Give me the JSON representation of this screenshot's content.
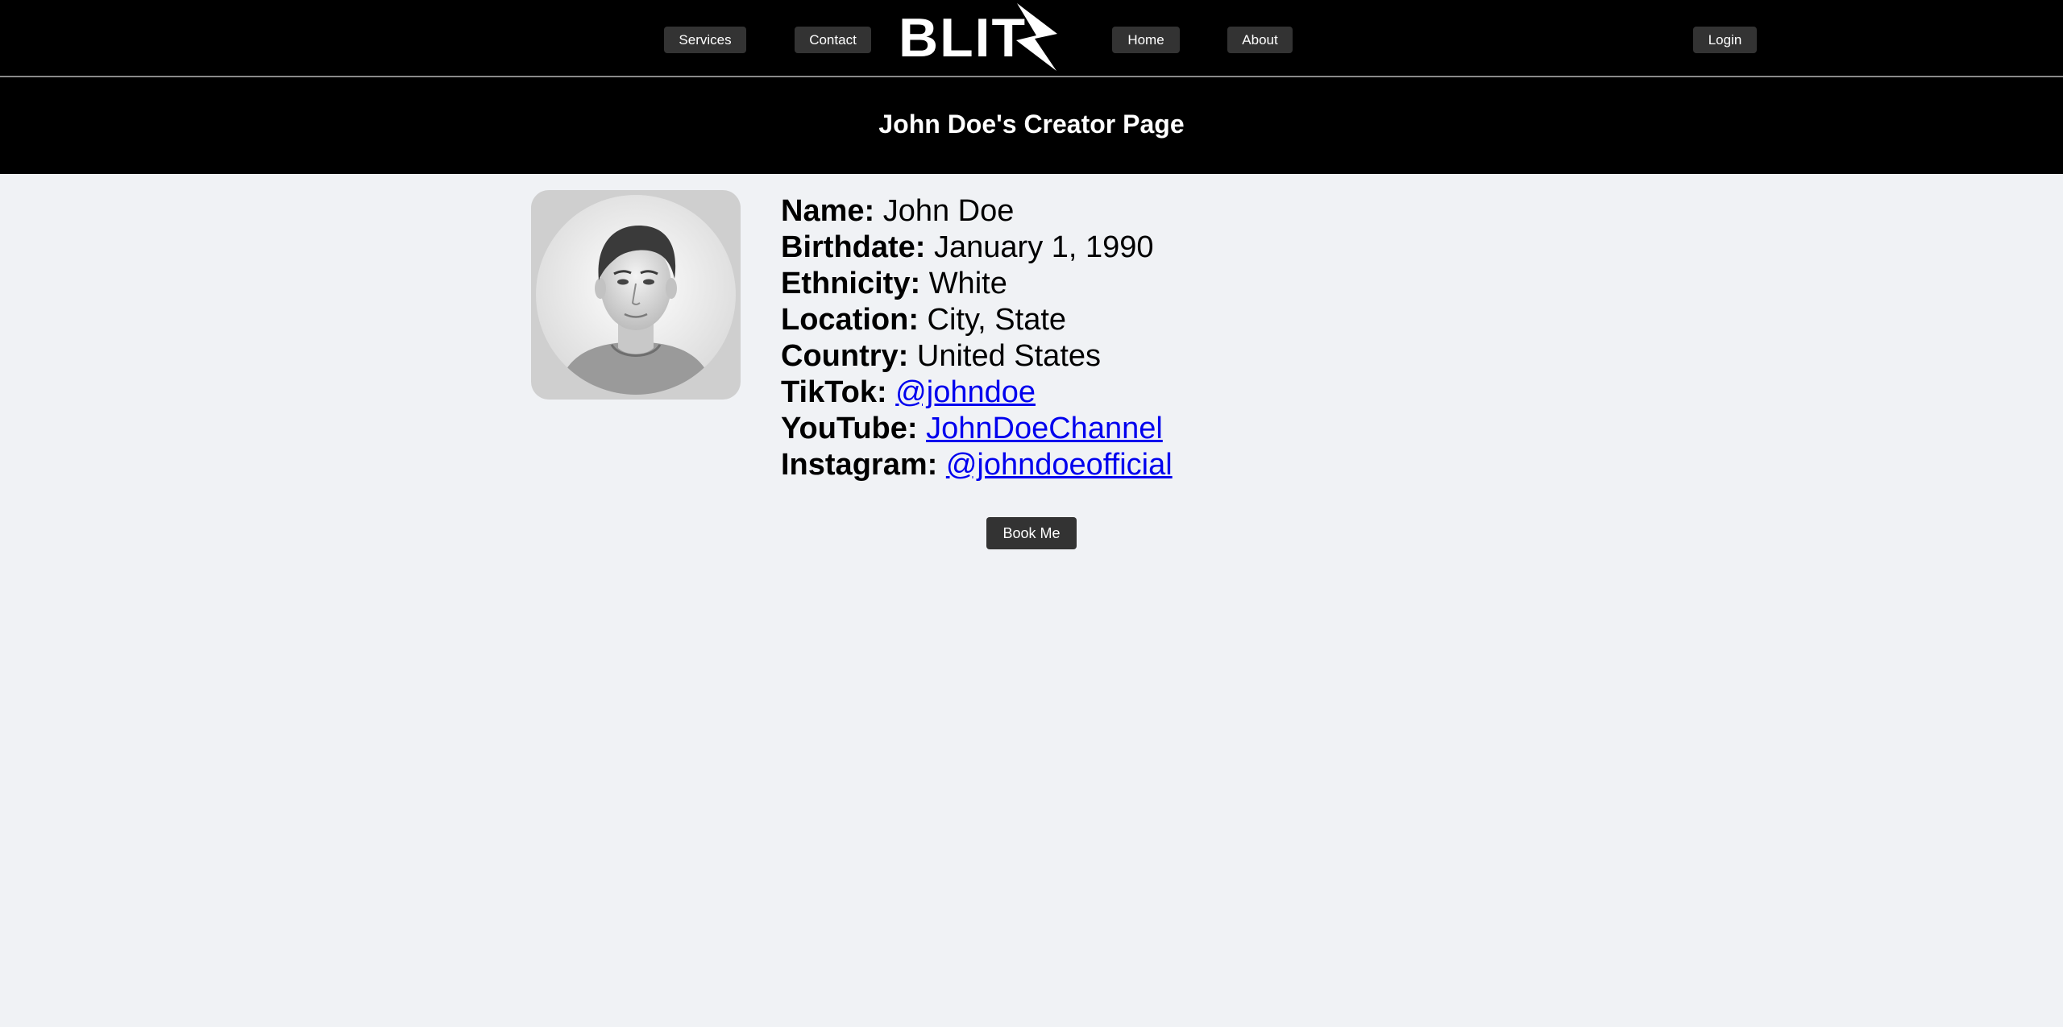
{
  "nav": {
    "services_label": "Services",
    "contact_label": "Contact",
    "home_label": "Home",
    "about_label": "About",
    "login_label": "Login",
    "logo_text": "BLIT"
  },
  "banner": {
    "title": "John Doe's Creator Page"
  },
  "profile": {
    "avatar_icon": "person-portrait",
    "fields": [
      {
        "label": "Name:",
        "value": "John Doe"
      },
      {
        "label": "Birthdate:",
        "value": "January 1, 1990"
      },
      {
        "label": "Ethnicity:",
        "value": "White"
      },
      {
        "label": "Location:",
        "value": "City, State"
      },
      {
        "label": "Country:",
        "value": "United States"
      }
    ],
    "links": [
      {
        "label": "TikTok:",
        "value": "@johndoe"
      },
      {
        "label": "YouTube:",
        "value": "JohnDoeChannel"
      },
      {
        "label": "Instagram:",
        "value": "@johndoeofficial"
      }
    ]
  },
  "actions": {
    "book_label": "Book Me"
  },
  "colors": {
    "background": "#f0f2f5",
    "header": "#000000",
    "button": "#333333",
    "link": "#0000ee"
  }
}
